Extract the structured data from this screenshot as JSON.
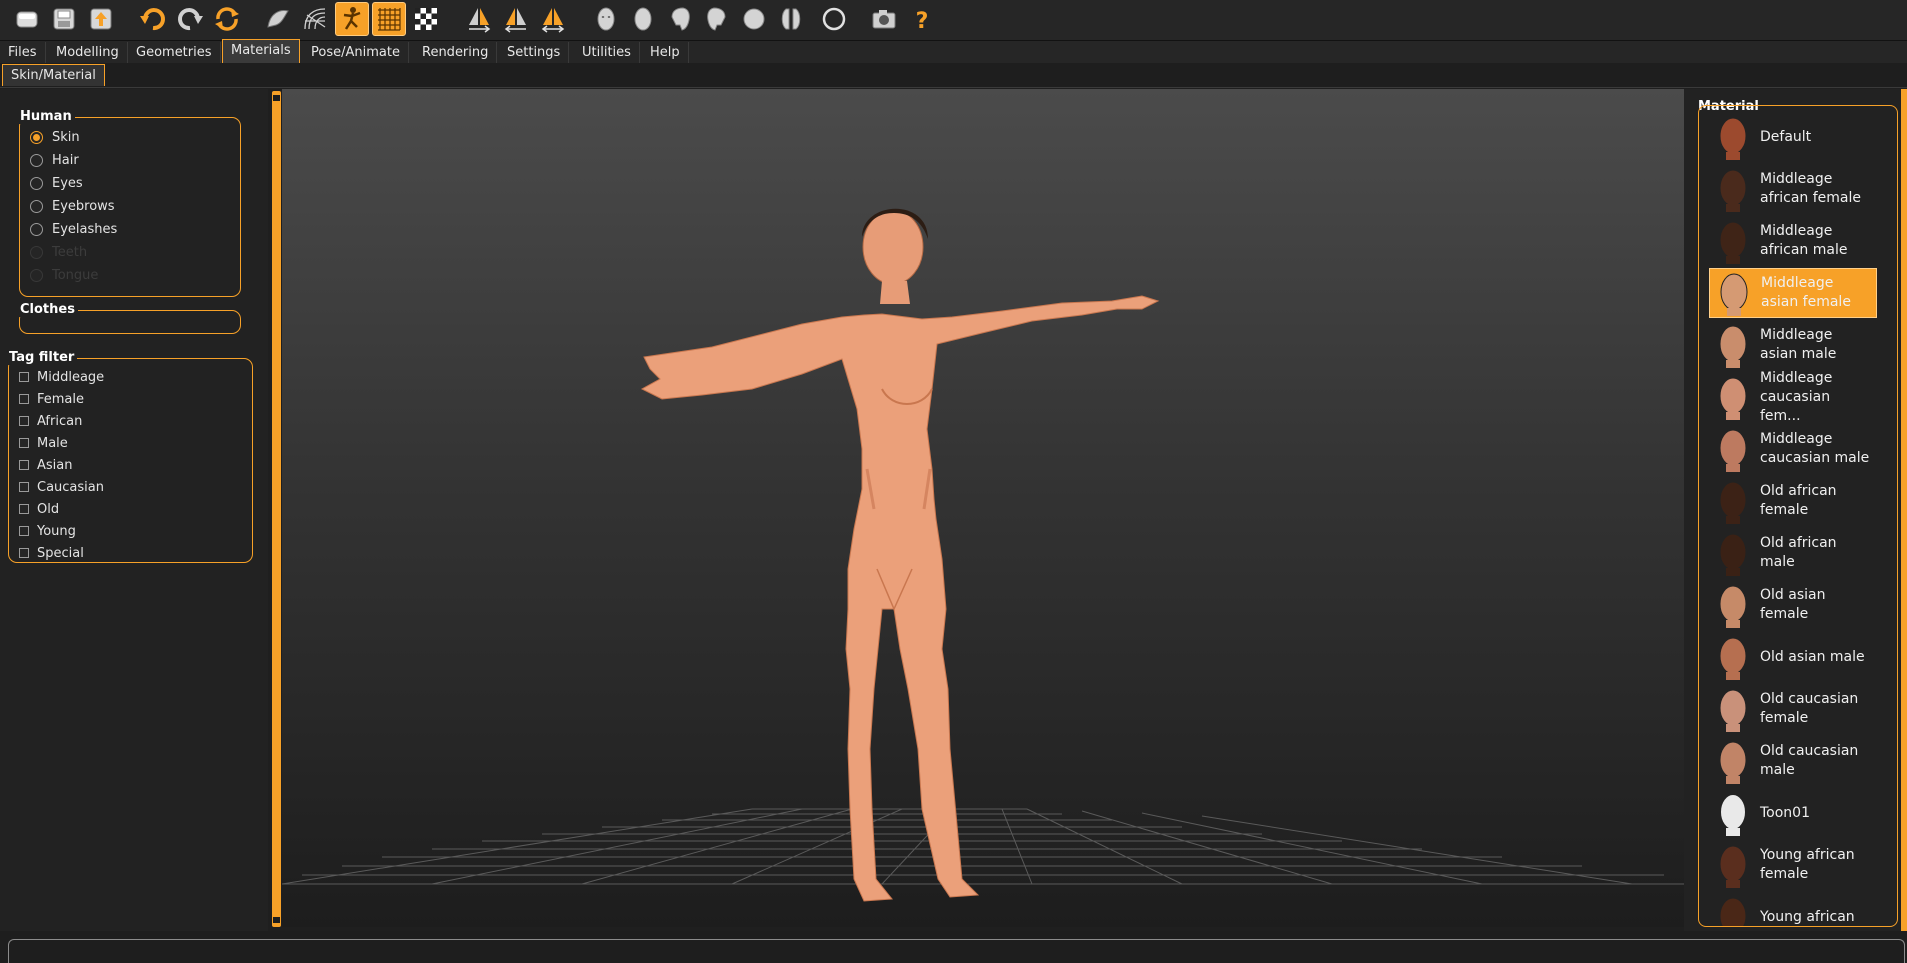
{
  "toolbar": {
    "icons": [
      "new-icon",
      "save-icon",
      "export-icon",
      "undo-icon",
      "redo-icon",
      "reset-icon",
      "smooth-icon",
      "wireframe-icon",
      "pose-icon",
      "grid-icon",
      "checker-background-icon",
      "symmetry-right-icon",
      "symmetry-left-icon",
      "symmetry-icon",
      "front-view-icon",
      "back-view-icon",
      "left-view-icon",
      "right-view-icon",
      "top-view-icon",
      "bottom-view-icon",
      "reset-camera-icon",
      "screenshot-icon",
      "help-icon"
    ]
  },
  "menu": {
    "tabs": [
      "Files",
      "Modelling",
      "Geometries",
      "Materials",
      "Pose/Animate",
      "Rendering",
      "Settings",
      "Utilities",
      "Help"
    ],
    "active": "Materials"
  },
  "subtab": {
    "label": "Skin/Material"
  },
  "human_group": {
    "title": "Human",
    "options": [
      {
        "label": "Skin",
        "checked": true,
        "enabled": true
      },
      {
        "label": "Hair",
        "checked": false,
        "enabled": true
      },
      {
        "label": "Eyes",
        "checked": false,
        "enabled": true
      },
      {
        "label": "Eyebrows",
        "checked": false,
        "enabled": true
      },
      {
        "label": "Eyelashes",
        "checked": false,
        "enabled": true
      },
      {
        "label": "Teeth",
        "checked": false,
        "enabled": false
      },
      {
        "label": "Tongue",
        "checked": false,
        "enabled": false
      }
    ]
  },
  "clothes_group": {
    "title": "Clothes"
  },
  "tag_filter": {
    "title": "Tag filter",
    "tags": [
      "Middleage",
      "Female",
      "African",
      "Male",
      "Asian",
      "Caucasian",
      "Old",
      "Young",
      "Special"
    ]
  },
  "material": {
    "title": "Material",
    "items": [
      {
        "label": "Default",
        "tone": "#9c4a2e",
        "selected": false
      },
      {
        "label": "Middleage african female",
        "tone": "#4a2a1c",
        "selected": false
      },
      {
        "label": "Middleage african male",
        "tone": "#3f2417",
        "selected": false
      },
      {
        "label": "Middleage asian female",
        "tone": "#d59a73",
        "selected": true
      },
      {
        "label": "Middleage asian male",
        "tone": "#c98d6c",
        "selected": false
      },
      {
        "label": "Middleage caucasian fem...",
        "tone": "#cf8f73",
        "selected": false
      },
      {
        "label": "Middleage caucasian male",
        "tone": "#bd7a60",
        "selected": false
      },
      {
        "label": "Old african female",
        "tone": "#3c2216",
        "selected": false
      },
      {
        "label": "Old african male",
        "tone": "#3a2115",
        "selected": false
      },
      {
        "label": "Old asian female",
        "tone": "#c68a68",
        "selected": false
      },
      {
        "label": "Old asian male",
        "tone": "#b66f50",
        "selected": false
      },
      {
        "label": "Old caucasian female",
        "tone": "#c9917a",
        "selected": false
      },
      {
        "label": "Old caucasian male",
        "tone": "#c18467",
        "selected": false
      },
      {
        "label": "Toon01",
        "tone": "#e9e9e9",
        "selected": false
      },
      {
        "label": "Young african female",
        "tone": "#5a2e1e",
        "selected": false
      },
      {
        "label": "Young african",
        "tone": "#4a2717",
        "selected": false
      }
    ]
  },
  "colors": {
    "accent": "#f7a128",
    "background": "#222222",
    "skin": "#eba07a"
  }
}
